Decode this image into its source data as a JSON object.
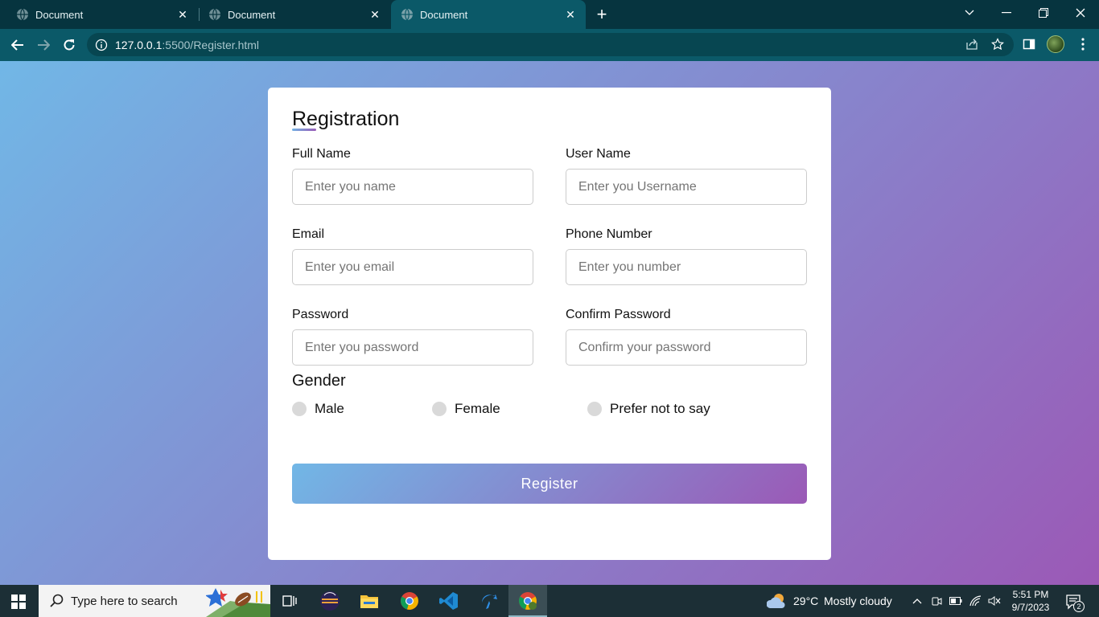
{
  "browser": {
    "tabs": [
      {
        "title": "Document",
        "active": false
      },
      {
        "title": "Document",
        "active": false
      },
      {
        "title": "Document",
        "active": true
      }
    ],
    "url_host": "127.0.0.1",
    "url_rest": ":5500/Register.html"
  },
  "form": {
    "title": "Registration",
    "fields": [
      {
        "label": "Full Name",
        "placeholder": "Enter you name"
      },
      {
        "label": "User Name",
        "placeholder": "Enter you Username"
      },
      {
        "label": "Email",
        "placeholder": "Enter you email"
      },
      {
        "label": "Phone Number",
        "placeholder": "Enter you number"
      },
      {
        "label": "Password",
        "placeholder": "Enter you password"
      },
      {
        "label": "Confirm Password",
        "placeholder": "Confirm your password"
      }
    ],
    "gender_title": "Gender",
    "gender_options": [
      "Male",
      "Female",
      "Prefer not to say"
    ],
    "submit_label": "Register"
  },
  "taskbar": {
    "search_placeholder": "Type here to search",
    "weather_temp": "29°C",
    "weather_desc": "Mostly cloudy",
    "time": "5:51 PM",
    "date": "9/7/2023",
    "notification_count": "2"
  },
  "colors": {
    "gradient_start": "#71b7e6",
    "gradient_end": "#9b59b6",
    "chrome_bg": "#0b5968"
  }
}
